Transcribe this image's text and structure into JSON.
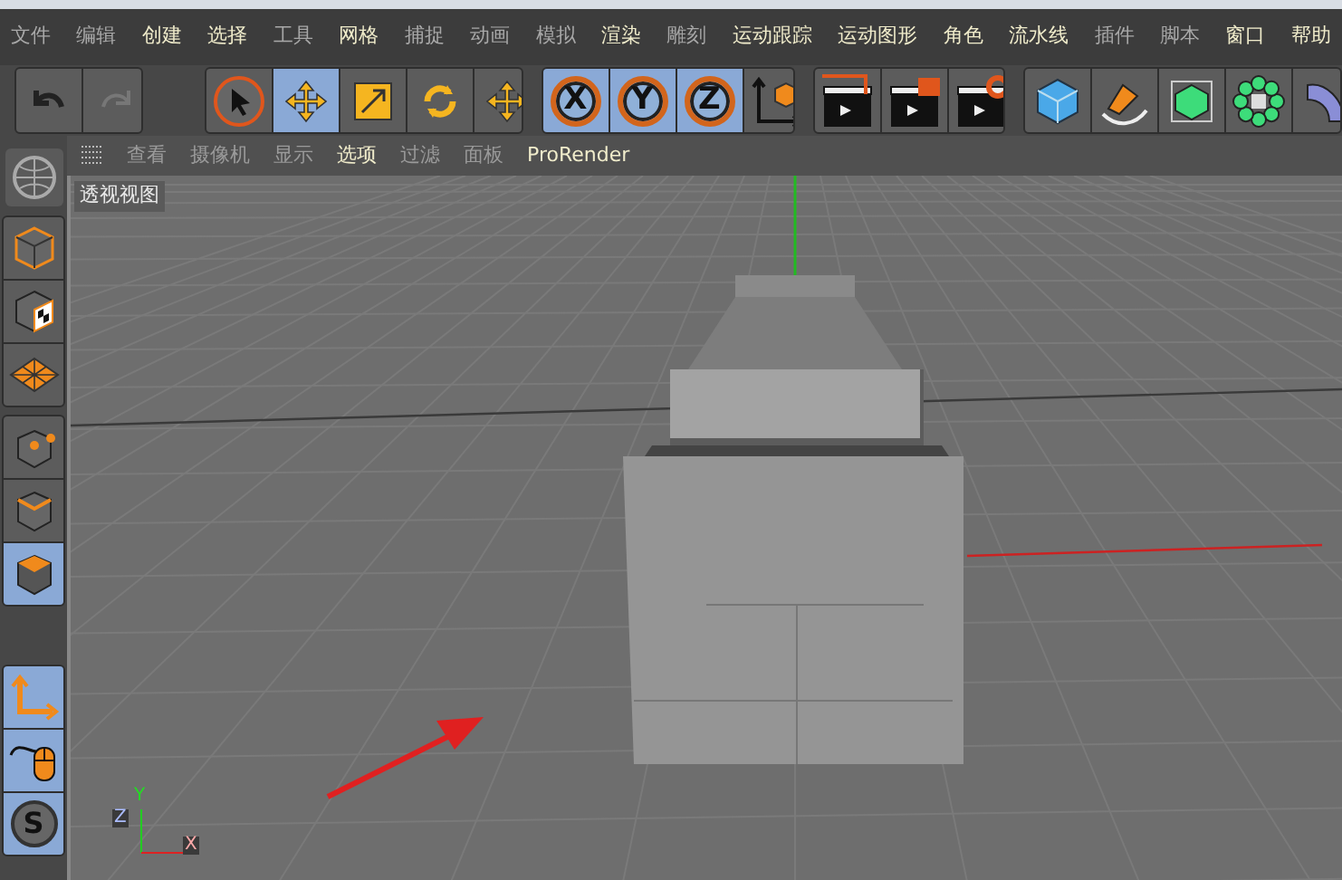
{
  "menu_bar": [
    {
      "label": "文件",
      "highlighted": false
    },
    {
      "label": "编辑",
      "highlighted": false
    },
    {
      "label": "创建",
      "highlighted": true
    },
    {
      "label": "选择",
      "highlighted": true
    },
    {
      "label": "工具",
      "highlighted": false
    },
    {
      "label": "网格",
      "highlighted": true
    },
    {
      "label": "捕捉",
      "highlighted": false
    },
    {
      "label": "动画",
      "highlighted": false
    },
    {
      "label": "模拟",
      "highlighted": false
    },
    {
      "label": "渲染",
      "highlighted": true
    },
    {
      "label": "雕刻",
      "highlighted": false
    },
    {
      "label": "运动跟踪",
      "highlighted": true
    },
    {
      "label": "运动图形",
      "highlighted": true
    },
    {
      "label": "角色",
      "highlighted": true
    },
    {
      "label": "流水线",
      "highlighted": true
    },
    {
      "label": "插件",
      "highlighted": false
    },
    {
      "label": "脚本",
      "highlighted": false
    },
    {
      "label": "窗口",
      "highlighted": true
    },
    {
      "label": "帮助",
      "highlighted": true
    }
  ],
  "toolbar": [
    [
      {
        "kind": "undo",
        "selected": false
      },
      {
        "kind": "redo",
        "selected": false
      }
    ],
    [
      {
        "kind": "select",
        "selected": false
      },
      {
        "kind": "move",
        "selected": true
      },
      {
        "kind": "scale",
        "selected": false
      },
      {
        "kind": "rotate",
        "selected": false
      },
      {
        "kind": "move",
        "selected": false
      }
    ],
    [
      {
        "kind": "axis",
        "label": "X",
        "selected": true
      },
      {
        "kind": "axis",
        "label": "Y",
        "selected": true
      },
      {
        "kind": "axis",
        "label": "Z",
        "selected": true
      },
      {
        "kind": "coords",
        "selected": false
      }
    ],
    [
      {
        "kind": "render-region",
        "selected": false
      },
      {
        "kind": "render-view",
        "selected": false
      },
      {
        "kind": "render-settings",
        "selected": false
      }
    ],
    [
      {
        "kind": "cube",
        "selected": false
      },
      {
        "kind": "pen",
        "selected": false
      },
      {
        "kind": "subdivision",
        "selected": false
      },
      {
        "kind": "cloner",
        "selected": false
      },
      {
        "kind": "deformer",
        "selected": false
      }
    ]
  ],
  "viewport_menu": [
    {
      "label": "查看",
      "highlighted": false
    },
    {
      "label": "摄像机",
      "highlighted": false
    },
    {
      "label": "显示",
      "highlighted": false
    },
    {
      "label": "选项",
      "highlighted": true
    },
    {
      "label": "过滤",
      "highlighted": false
    },
    {
      "label": "面板",
      "highlighted": false
    },
    {
      "label": "ProRender",
      "highlighted": true
    }
  ],
  "left_toolbar": [
    [
      {
        "kind": "model",
        "selected": false
      },
      {
        "kind": "texture",
        "selected": false
      },
      {
        "kind": "workplane",
        "selected": false
      }
    ],
    [
      {
        "kind": "points",
        "selected": false
      },
      {
        "kind": "edges",
        "selected": false
      },
      {
        "kind": "polygons",
        "selected": true
      }
    ],
    [
      {
        "kind": "axis-mode",
        "selected": true
      },
      {
        "kind": "mouse",
        "selected": true
      },
      {
        "kind": "snap",
        "label": "S",
        "selected": true
      }
    ]
  ],
  "viewport": {
    "title": "透视视图",
    "gizmo": {
      "y": "Y",
      "z": "Z",
      "x": "X"
    }
  }
}
